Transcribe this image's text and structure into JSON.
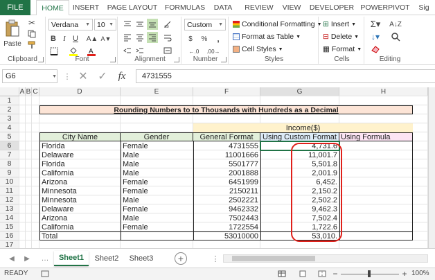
{
  "ribbon_tabs": [
    "FILE",
    "HOME",
    "INSERT",
    "PAGE LAYOUT",
    "FORMULAS",
    "DATA",
    "REVIEW",
    "VIEW",
    "DEVELOPER",
    "POWERPIVOT",
    "Sig"
  ],
  "ribbon": {
    "paste_label": "Paste",
    "font_name": "Verdana",
    "font_size": "10",
    "number_format": "Custom",
    "conditional_formatting": "Conditional Formatting",
    "format_as_table": "Format as Table",
    "cell_styles": "Cell Styles",
    "insert": "Insert",
    "delete": "Delete",
    "format": "Format",
    "groups": {
      "clipboard": "Clipboard",
      "font": "Font",
      "alignment": "Alignment",
      "number": "Number",
      "styles": "Styles",
      "cells": "Cells",
      "editing": "Editing"
    }
  },
  "formula_bar": {
    "name_box": "G6",
    "value": "4731555"
  },
  "columns": [
    "A",
    "B",
    "C",
    "D",
    "E",
    "F",
    "G",
    "H"
  ],
  "rows": [
    "1",
    "2",
    "3",
    "4",
    "5",
    "6",
    "7",
    "8",
    "9",
    "10",
    "11",
    "12",
    "13",
    "14",
    "15",
    "16",
    "17"
  ],
  "sheet": {
    "title": "Rounding Numbers to to Thousands with Hundreds as a Decimal",
    "income_header": "Income($)",
    "headers": [
      "City Name",
      "Gender",
      "General Format",
      "Using Custom Format",
      "Using Formula"
    ],
    "data": [
      [
        "Florida",
        "Female",
        "4731555",
        "4,731.6"
      ],
      [
        "Delaware",
        "Male",
        "11001666",
        "11,001.7"
      ],
      [
        "Florida",
        "Male",
        "5501777",
        "5,501.8"
      ],
      [
        "California",
        "Male",
        "2001888",
        "2,001.9"
      ],
      [
        "Arizona",
        "Female",
        "6451999",
        "6,452."
      ],
      [
        "Minnesota",
        "Female",
        "2150211",
        "2,150.2"
      ],
      [
        "Minnesota",
        "Male",
        "2502221",
        "2,502.2"
      ],
      [
        "Delaware",
        "Female",
        "9462332",
        "9,462.3"
      ],
      [
        "Arizona",
        "Male",
        "7502443",
        "7,502.4"
      ],
      [
        "California",
        "Female",
        "1722554",
        "1,722.6"
      ]
    ],
    "total": [
      "Total",
      "",
      "53010000",
      "53,010."
    ]
  },
  "sheet_tabs": [
    "Sheet1",
    "Sheet2",
    "Sheet3"
  ],
  "status": {
    "ready": "READY",
    "zoom": "100%"
  },
  "colors": {
    "accent": "#217346",
    "title_fill": "#fce4d6",
    "header_fill": "#e2efda",
    "custom_fill": "#ddebf7",
    "formula_fill": "#fce4f3",
    "income_fill": "#fff2cc",
    "highlight": "#e0201a"
  }
}
